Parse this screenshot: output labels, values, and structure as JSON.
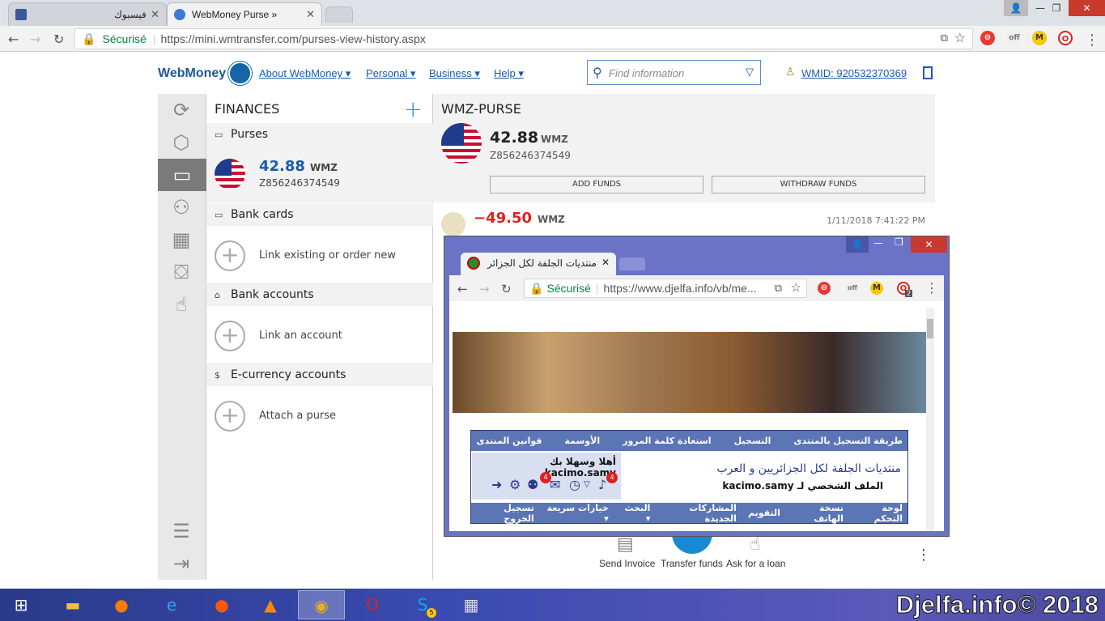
{
  "browser": {
    "tabs": [
      {
        "title": "فيسبوك"
      },
      {
        "title": "WebMoney Purse »"
      }
    ],
    "secure_label": "Sécurisé",
    "url": "https://mini.wmtransfer.com/purses-view-history.aspx",
    "ext_badge_off": "off",
    "ext_m": "M"
  },
  "wm": {
    "logo": "WebMoney",
    "nav": [
      "About WebMoney ▾",
      "Personal ▾",
      "Business ▾",
      "Help ▾"
    ],
    "search_placeholder": "Find information",
    "wmid": "WMID: 920532370369"
  },
  "finances": {
    "title": "FINANCES",
    "purses_label": "Purses",
    "purse_amount": "42.88",
    "purse_currency": "WMZ",
    "purse_id": "Z856246374549",
    "bank_cards_label": "Bank cards",
    "bank_cards_link": "Link existing or order new",
    "bank_accounts_label": "Bank accounts",
    "bank_accounts_link": "Link an account",
    "ecurrency_label": "E-currency accounts",
    "ecurrency_link": "Attach a purse"
  },
  "purse": {
    "title": "WMZ-PURSE",
    "amount": "42.88",
    "currency": "WMZ",
    "id": "Z856246374549",
    "add_funds": "ADD FUNDS",
    "withdraw_funds": "WITHDRAW FUNDS",
    "tx_amount": "−49.50",
    "tx_currency": "WMZ",
    "tx_date": "1/11/2018 7:41:22 PM"
  },
  "actions": {
    "send_invoice": "Send Invoice",
    "transfer_funds": "Transfer funds",
    "ask_loan": "Ask for a loan"
  },
  "popup": {
    "tab_title": "منتديات الجلفة لكل الجزائر",
    "secure_label": "Sécurisé",
    "url": "https://www.djelfa.info/vb/me...",
    "nav_top": [
      "طريقة التسجيل بالمنتدى",
      "التسجيل",
      "استعادة كلمة المرور",
      "الأوسمة",
      "قوانين المنتدى"
    ],
    "forum_title": "منتديات الجلفة لكل الجزائريين و العرب",
    "profile_link": "الملف الشخصي لـ kacimo.samy",
    "welcome": "أهلا وسهلا بك kacimo.samy.",
    "badge_count": "4",
    "nav_bottom": [
      "لوحة التحكم",
      "نسخة الهاتف",
      "التقويم",
      "المشاركات الجديدة",
      "البحث ▾",
      "خيارات سريعة ▾",
      "تسجيل الخروج"
    ],
    "ext_badge": "2"
  },
  "taskbar": {
    "copyright": "Djelfa.info© 2018",
    "skype_badge": "5"
  },
  "colors": {
    "wm_blue": "#1a5ab0",
    "negative": "#e02020",
    "popup_frame": "#6a73c6",
    "forum_bar": "#5b75b5"
  }
}
